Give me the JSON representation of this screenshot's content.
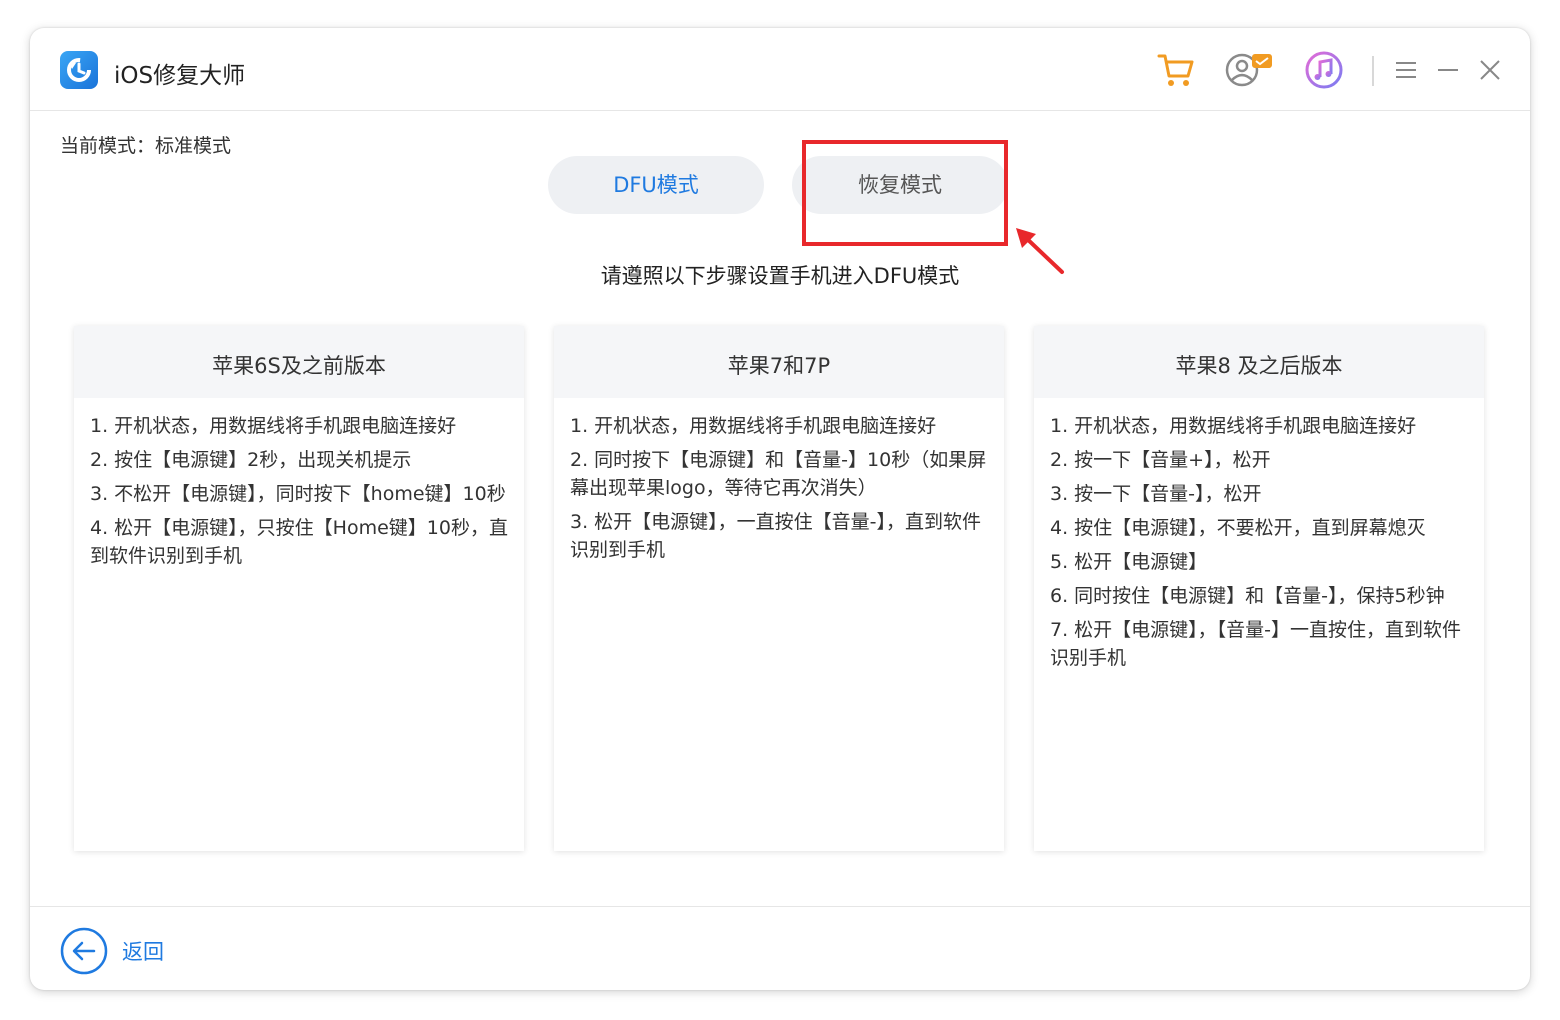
{
  "app": {
    "title": "iOS修复大师",
    "icons": [
      "cart-icon",
      "support-icon",
      "itunes-icon",
      "menu-icon",
      "minimize-icon",
      "close-icon"
    ]
  },
  "mode": {
    "label": "当前模式：",
    "value": "标准模式"
  },
  "tabs": [
    {
      "label": "DFU模式",
      "active": true
    },
    {
      "label": "恢复模式",
      "active": false
    }
  ],
  "instruction": "请遵照以下步骤设置手机进入DFU模式",
  "cards": [
    {
      "title": "苹果6S及之前版本",
      "steps": [
        "1. 开机状态，用数据线将手机跟电脑连接好",
        "2. 按住【电源键】2秒，出现关机提示",
        "3. 不松开【电源键】，同时按下【home键】10秒",
        "4. 松开【电源键】，只按住【Home键】10秒，直到软件识别到手机"
      ]
    },
    {
      "title": "苹果7和7P",
      "steps": [
        "1. 开机状态，用数据线将手机跟电脑连接好",
        "2. 同时按下【电源键】和【音量-】10秒（如果屏幕出现苹果logo，等待它再次消失）",
        "3. 松开【电源键】，一直按住【音量-】，直到软件识别到手机"
      ]
    },
    {
      "title": "苹果8 及之后版本",
      "steps": [
        "1. 开机状态，用数据线将手机跟电脑连接好",
        "2. 按一下【音量+】，松开",
        "3. 按一下【音量-】，松开",
        "4. 按住【电源键】，不要松开，直到屏幕熄灭",
        "5. 松开【电源键】",
        "6. 同时按住【电源键】和【音量-】，保持5秒钟",
        "7. 松开【电源键】，【音量-】一直按住，直到软件识别手机"
      ]
    }
  ],
  "footer": {
    "back_label": "返回"
  },
  "colors": {
    "accent": "#1f7ae0",
    "highlight": "#e8282b"
  }
}
